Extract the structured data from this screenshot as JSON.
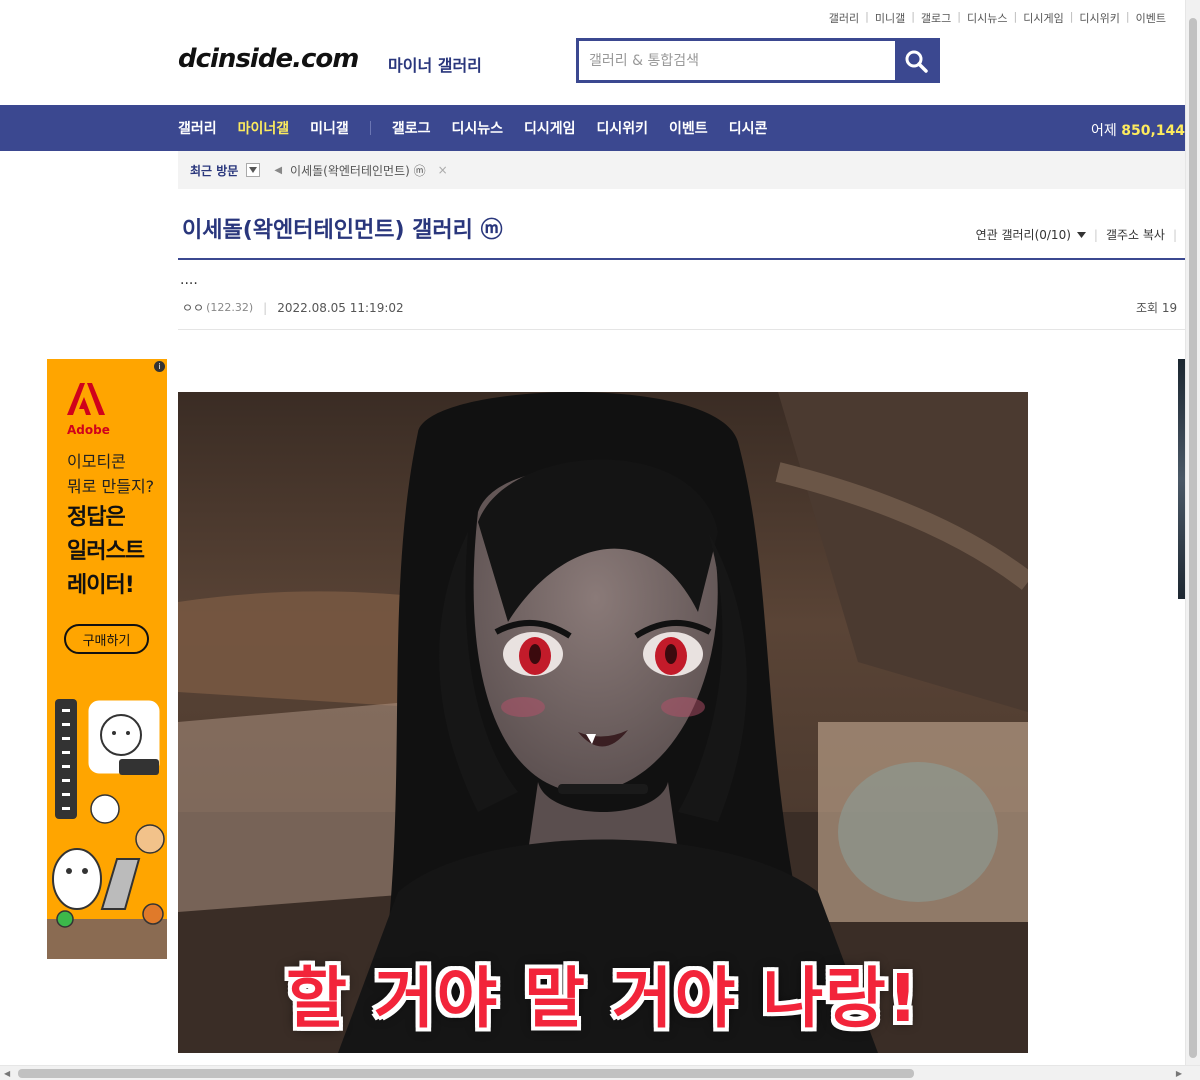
{
  "util_links": [
    "갤러리",
    "미니갤",
    "갤로그",
    "디시뉴스",
    "디시게임",
    "디시위키",
    "이벤트"
  ],
  "header": {
    "logo": "dcinside.com",
    "logo_sub": "마이너 갤러리",
    "search_placeholder": "갤러리 & 통합검색"
  },
  "nav": {
    "items": [
      "갤러리",
      "마이너갤",
      "미니갤",
      "갤로그",
      "디시뉴스",
      "디시게임",
      "디시위키",
      "이벤트",
      "디시콘"
    ],
    "active": "마이너갤",
    "yesterday_label": "어제",
    "yesterday_count": "850,144"
  },
  "recent": {
    "label": "최근 방문",
    "item": "이세돌(왁엔터테인먼트) ⓜ",
    "close": "×"
  },
  "gallery": {
    "title": "이세돌(왁엔터테인먼트) 갤러리",
    "badge": "ⓜ",
    "related": "연관 갤러리(0/10)",
    "copy_address": "갤주소 복사"
  },
  "post": {
    "title": "....",
    "author": "ㅇㅇ",
    "ip": "(122.32)",
    "date": "2022.08.05 11:19:02",
    "views_label": "조회 19"
  },
  "ad": {
    "brand": "Adobe",
    "line1a": "이모티콘",
    "line1b": "뭐로 만들지?",
    "line2a": "정답은",
    "line2b": "일러스트",
    "line2c": "레이터!",
    "button": "구매하기",
    "info": "i"
  },
  "image": {
    "caption": "할 거야 말 거야 나랑!"
  },
  "colors": {
    "brand_blue": "#3b4890",
    "active_yellow": "#fdeb5e",
    "ad_orange": "#ffa500",
    "caption_red": "#f2243a"
  }
}
